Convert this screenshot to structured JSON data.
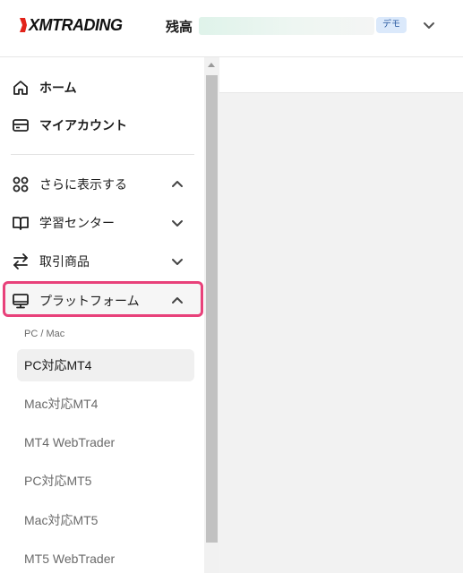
{
  "header": {
    "logo_text": "XMTRADING",
    "balance_label": "残高",
    "account_badge": "デモ"
  },
  "sidebar": {
    "items": [
      {
        "label": "ホーム",
        "icon": "home-icon"
      },
      {
        "label": "マイアカウント",
        "icon": "card-icon"
      },
      {
        "label": "さらに表示する",
        "icon": "grid-icon",
        "expanded": true
      },
      {
        "label": "学習センター",
        "icon": "book-icon",
        "expanded": false
      },
      {
        "label": "取引商品",
        "icon": "transfer-icon",
        "expanded": false
      },
      {
        "label": "プラットフォーム",
        "icon": "monitor-icon",
        "expanded": true
      }
    ],
    "platform_section": {
      "caption": "PC / Mac",
      "items": [
        {
          "label": "PC対応MT4",
          "active": true
        },
        {
          "label": "Mac対応MT4",
          "active": false
        },
        {
          "label": "MT4 WebTrader",
          "active": false
        },
        {
          "label": "PC対応MT5",
          "active": false
        },
        {
          "label": "Mac対応MT5",
          "active": false
        },
        {
          "label": "MT5 WebTrader",
          "active": false
        }
      ]
    }
  },
  "colors": {
    "highlight_border": "#e8417a",
    "badge_bg": "#dbe9fb",
    "badge_text": "#2a5aa0"
  }
}
